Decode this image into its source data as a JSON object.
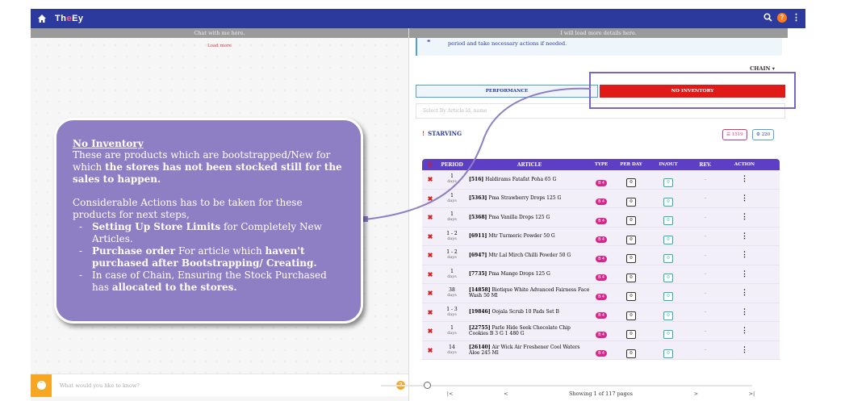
{
  "header": {
    "brand_prefix": "Th",
    "brand_mid": "e",
    "brand_suffix": "Ey",
    "help_badge": "?"
  },
  "chat": {
    "header": "Chat with me here.",
    "load_more": "Load more",
    "placeholder": "What would you like to know?",
    "help_badge": "?"
  },
  "details": {
    "header": "I will load more details here.",
    "info_text": "period and take necessary actions if needed.",
    "chain_label": "CHAIN",
    "tabs": {
      "performance": "PERFORMANCE",
      "no_inventory": "NO INVENTORY"
    },
    "search_placeholder": "Select By Article Id, name",
    "section_title": "STARVING",
    "count_a": "1519",
    "count_b": "220",
    "columns": [
      "PERIOD",
      "ARTICLE",
      "TYPE",
      "PER DAY",
      "IN/OUT",
      "REV.",
      "ACTION"
    ],
    "rows": [
      {
        "period": "1",
        "unit": "days",
        "id": "[516]",
        "name": "Haldirams Fatafat Poha 65 G",
        "type": "B 4",
        "per_day": "0",
        "in_out": "0",
        "rev": "-"
      },
      {
        "period": "1",
        "unit": "days",
        "id": "[5363]",
        "name": "Pma Strawberry Drops 125 G",
        "type": "B 4",
        "per_day": "0",
        "in_out": "0",
        "rev": "-"
      },
      {
        "period": "1",
        "unit": "days",
        "id": "[5368]",
        "name": "Pma Vanilla Drops 125 G",
        "type": "B 4",
        "per_day": "0",
        "in_out": "0",
        "rev": "-"
      },
      {
        "period": "1 - 2",
        "unit": "days",
        "id": "[6911]",
        "name": "Mtr Turmeric Powder 50 G",
        "type": "B 4",
        "per_day": "0",
        "in_out": "0",
        "rev": "-"
      },
      {
        "period": "1 - 2",
        "unit": "days",
        "id": "[6947]",
        "name": "Mtr Lal Mirch Chilli Powder 50 G",
        "type": "B 4",
        "per_day": "0",
        "in_out": "0",
        "rev": "-"
      },
      {
        "period": "1",
        "unit": "days",
        "id": "[7735]",
        "name": "Pma Mango Drops 125 G",
        "type": "B 4",
        "per_day": "0",
        "in_out": "0",
        "rev": "-"
      },
      {
        "period": "38",
        "unit": "days",
        "id": "[14858]",
        "name": "Biotique White Advanced Fairness Face Wash 50 Ml",
        "type": "B 4",
        "per_day": "0",
        "in_out": "0",
        "rev": "-"
      },
      {
        "period": "1 - 3",
        "unit": "days",
        "id": "[19846]",
        "name": "Oojala Scrub 10 Pads Set B",
        "type": "B 4",
        "per_day": "0",
        "in_out": "0",
        "rev": "-"
      },
      {
        "period": "1",
        "unit": "days",
        "id": "[22755]",
        "name": "Parle Hide Seek Chocolate Chip Cookies B 3 G 1 480 G",
        "type": "B 4",
        "per_day": "0",
        "in_out": "0",
        "rev": "-"
      },
      {
        "period": "14",
        "unit": "days",
        "id": "[26140]",
        "name": "Air Wick Air Freshener Cool Waters Aloe 245 Ml",
        "type": "B 4",
        "per_day": "0",
        "in_out": "0",
        "rev": "-"
      }
    ],
    "pager": {
      "first": "|<",
      "prev": "<",
      "info": "Showing 1 of 117 pages",
      "next": ">",
      "last": ">|"
    }
  },
  "annotation": {
    "title": "No Inventory",
    "p1_a": "These are products which are bootstrapped/New for which ",
    "p1_b": "the stores has not been stocked still for the sales to happen.",
    "p2": "Considerable Actions has to be taken for these products for next steps,",
    "li1_a": "Setting Up Store Limits",
    "li1_b": " for Completely New Articles.",
    "li2_a": "Purchase order",
    "li2_b": " For article which ",
    "li2_c": "haven't purchased after Bootstrapping/ Creating.",
    "li3_a": "In case of Chain, Ensuring the Stock Purchased has ",
    "li3_b": "allocated to the stores."
  }
}
